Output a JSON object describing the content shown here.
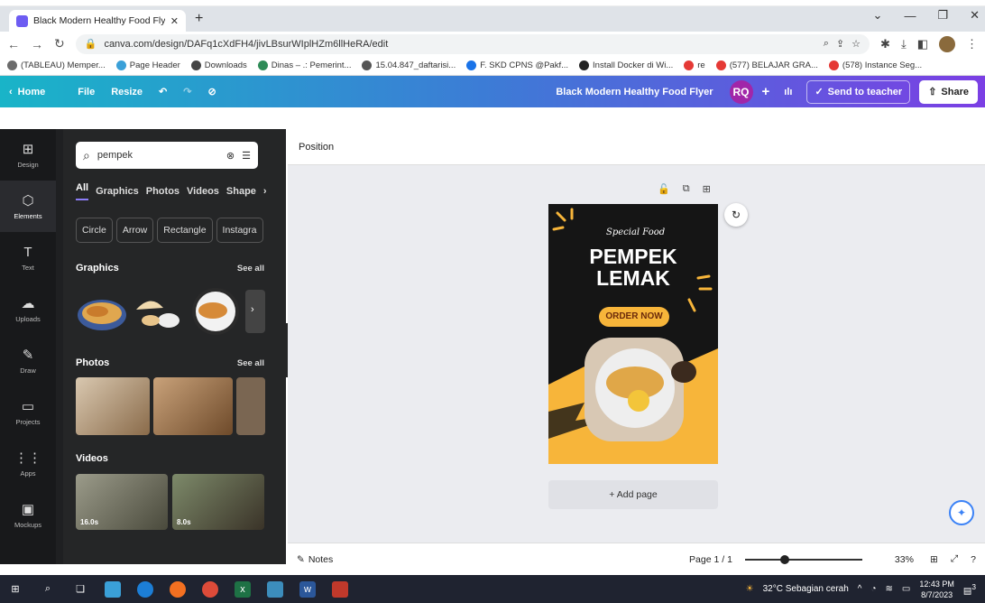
{
  "browser": {
    "tab_title": "Black Modern Healthy Food Flye",
    "new_tab": "+",
    "url": "canva.com/design/DAFq1cXdFH4/jivLBsurWIplHZm6llHeRA/edit"
  },
  "bookmarks": [
    {
      "label": "(TABLEAU) Memper...",
      "color": "#6b6b6b"
    },
    {
      "label": "Page Header",
      "color": "#3aa0d8"
    },
    {
      "label": "Downloads",
      "color": "#444444"
    },
    {
      "label": "Dinas – .: Pemerint...",
      "color": "#2e8b57"
    },
    {
      "label": "15.04.847_daftarisi...",
      "color": "#555555"
    },
    {
      "label": "F. SKD CPNS @Pakf...",
      "color": "#1a73e8"
    },
    {
      "label": "Install Docker di Wi...",
      "color": "#222222"
    },
    {
      "label": "re",
      "color": "#e53935"
    },
    {
      "label": "(577) BELAJAR GRA...",
      "color": "#e53935"
    },
    {
      "label": "(578) Instance Seg...",
      "color": "#e53935"
    }
  ],
  "header": {
    "home": "Home",
    "file": "File",
    "resize": "Resize",
    "design_title": "Black Modern Healthy Food Flyer",
    "avatar": "RQ",
    "plus": "+",
    "send": "Send to teacher",
    "share": "Share"
  },
  "rail": [
    {
      "label": "Design",
      "glyph": "⊞"
    },
    {
      "label": "Elements",
      "glyph": "⬡"
    },
    {
      "label": "Text",
      "glyph": "T"
    },
    {
      "label": "Uploads",
      "glyph": "☁"
    },
    {
      "label": "Draw",
      "glyph": "✎"
    },
    {
      "label": "Projects",
      "glyph": "▭"
    },
    {
      "label": "Apps",
      "glyph": "⋮⋮"
    },
    {
      "label": "Mockups",
      "glyph": "▣"
    }
  ],
  "panel": {
    "search_value": "pempek",
    "tabs": [
      "All",
      "Graphics",
      "Photos",
      "Videos",
      "Shape"
    ],
    "chips": [
      "Circle",
      "Arrow",
      "Rectangle",
      "Instagra"
    ],
    "graphics_title": "Graphics",
    "photos_title": "Photos",
    "videos_title": "Videos",
    "see_all": "See all",
    "video_durations": [
      "16.0s",
      "8.0s"
    ]
  },
  "canvas": {
    "position": "Position",
    "flyer": {
      "script": "Special Food",
      "line1": "PEMPEK",
      "line2": "LEMAK",
      "cta": "ORDER NOW"
    },
    "add_page": "+ Add page"
  },
  "footer": {
    "notes": "Notes",
    "page": "Page 1 / 1",
    "zoom": "33%",
    "zoom_value": 0.33
  },
  "taskbar": {
    "weather": "32°C  Sebagian cerah",
    "time": "12:43 PM",
    "date": "8/7/2023",
    "notif": "3"
  },
  "colors": {
    "accent": "#7b3fe4",
    "flyer_orange": "#f7b53a"
  }
}
